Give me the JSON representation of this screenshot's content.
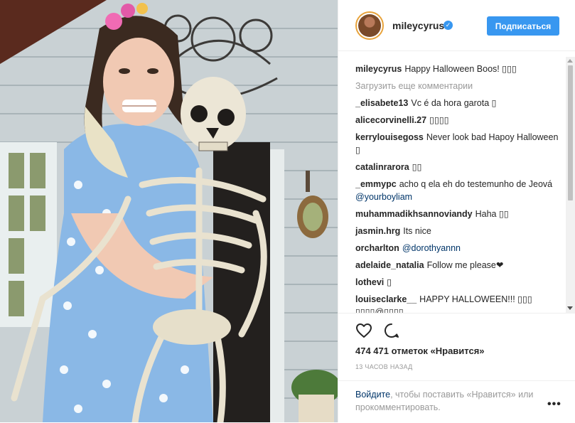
{
  "post": {
    "username": "mileycyrus",
    "verified_glyph": "✓",
    "follow_label": "Подписаться",
    "caption_user": "mileycyrus",
    "caption_text": "Happy Halloween Boos! ▯▯▯",
    "load_more": "Загрузить еще комментарии",
    "comments": [
      {
        "user": "_elisabete13",
        "text": "Vc é da hora garota ▯",
        "mention": ""
      },
      {
        "user": "alicecorvinelli.27",
        "text": "▯▯▯▯",
        "mention": ""
      },
      {
        "user": "kerrylouisegoss",
        "text": "Never look bad Hapoy Halloween ▯",
        "mention": ""
      },
      {
        "user": "catalinrarora",
        "text": "▯▯",
        "mention": ""
      },
      {
        "user": "_emmypc",
        "text": "acho q ela eh do testemunho de Jeová",
        "mention": "@yourboyliam"
      },
      {
        "user": "muhammadikhsannoviandy",
        "text": "Haha ▯▯",
        "mention": ""
      },
      {
        "user": "jasmin.hrg",
        "text": "Its nice",
        "mention": ""
      },
      {
        "user": "orcharlton",
        "text": "",
        "mention": "@dorothyannn"
      },
      {
        "user": "adelaide_natalia",
        "text": "Follow me please❤",
        "mention": ""
      },
      {
        "user": "lothevi",
        "text": "▯",
        "mention": ""
      },
      {
        "user": "louiseclarke__",
        "text": "HAPPY HALLOWEEN!!! ▯▯▯ ▯▯▯▯@▯▯▯▯",
        "mention": ""
      }
    ],
    "likes": "474 471 отметок «Нравится»",
    "time": "13 часов назад",
    "login_link": "Войдите",
    "login_rest": ", чтобы поставить «Нравится» или прокомментировать.",
    "more_glyph": "•••",
    "icons": {
      "like": "heart-outline-icon",
      "comment": "speech-bubble-icon",
      "more": "ellipsis-icon"
    },
    "colors": {
      "accent": "#3897f0",
      "link": "#003569",
      "muted": "#999999"
    }
  }
}
